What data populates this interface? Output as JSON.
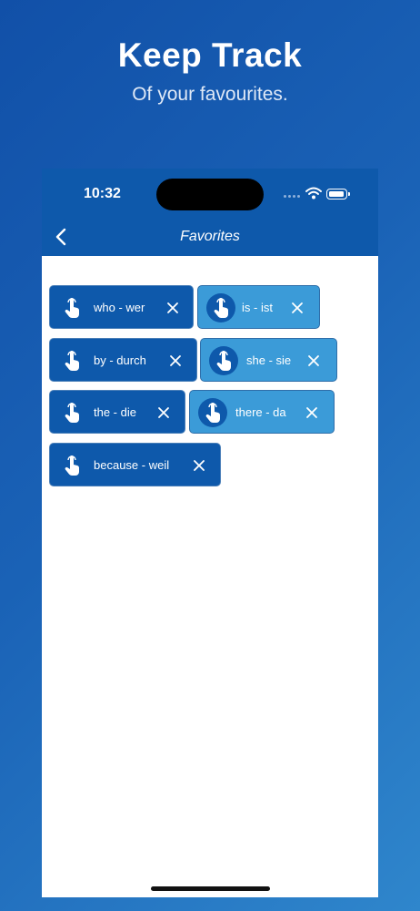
{
  "promo": {
    "title": "Keep Track",
    "subtitle": "Of your favourites."
  },
  "status_bar": {
    "time": "10:32"
  },
  "nav": {
    "title": "Favorites",
    "back_icon": "chevron-left-icon"
  },
  "favorites": [
    {
      "label": "who - wer",
      "style": "dark"
    },
    {
      "label": "is - ist",
      "style": "light"
    },
    {
      "label": "by - durch",
      "style": "dark"
    },
    {
      "label": "she - sie",
      "style": "light"
    },
    {
      "label": "the - die",
      "style": "dark"
    },
    {
      "label": "there - da",
      "style": "light"
    },
    {
      "label": "because - weil",
      "style": "dark"
    }
  ],
  "colors": {
    "nav_bar": "#0e59ab",
    "chip_dark": "#0e59ab",
    "chip_light": "#3b9bd8"
  },
  "icons": {
    "chip_icon": "tap-hand-icon",
    "remove_icon": "close-icon"
  }
}
